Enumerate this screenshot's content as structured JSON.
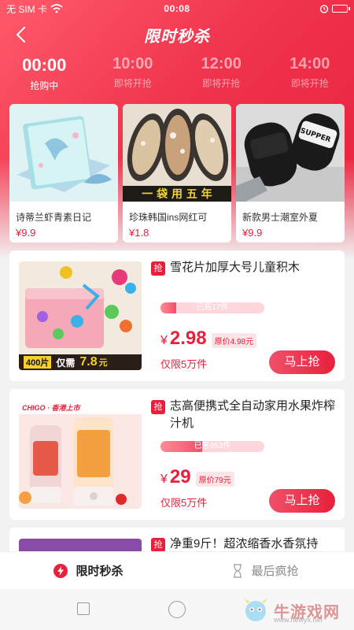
{
  "status_bar": {
    "carrier": "无 SIM 卡",
    "time": "00:08"
  },
  "nav": {
    "title": "限时秒杀"
  },
  "time_tabs": [
    {
      "time": "00:00",
      "status": "抢购中"
    },
    {
      "time": "10:00",
      "status": "即将开抢"
    },
    {
      "time": "12:00",
      "status": "即将开抢"
    },
    {
      "time": "14:00",
      "status": "即将开抢"
    }
  ],
  "hot_items": [
    {
      "name": "诗蒂兰虾青素日记",
      "price": "¥9.9",
      "image_text": ""
    },
    {
      "name": "珍珠韩国ins网红可",
      "price": "¥1.8",
      "image_text": "一 袋 用 五 年"
    },
    {
      "name": "新款男士潮室外夏",
      "price": "¥9.9",
      "image_text": "SUPPER"
    }
  ],
  "items": [
    {
      "tag": "抢",
      "title": "雪花片加厚大号儿童积木",
      "sold": "已售17件",
      "sold_fraction": 0.15,
      "currency": "¥",
      "price": "2.98",
      "original_price": "原价4.98元",
      "limit": "仅限5万件",
      "button": "马上抢",
      "image_banner_left": "400片",
      "image_banner_mid": "仅需",
      "image_banner_price": "7.8",
      "image_banner_unit": "元"
    },
    {
      "tag": "抢",
      "title": "志高便携式全自动家用水果炸榨汁机",
      "sold": "已售953件",
      "sold_fraction": 0.4,
      "currency": "¥",
      "price": "29",
      "original_price": "原价79元",
      "limit": "仅限5万件",
      "button": "马上抢",
      "image_brand": "CHIGO · 香港上市"
    },
    {
      "tag": "抢",
      "title": "净重9斤！超浓缩香水香氛持"
    }
  ],
  "bottom_tabs": [
    {
      "label": "限时秒杀",
      "icon": "lightning-icon"
    },
    {
      "label": "最后疯抢",
      "icon": "hourglass-icon"
    }
  ],
  "watermark": {
    "text": "牛游戏网",
    "url": "www.newyx.net"
  },
  "colors": {
    "accent": "#e8203c",
    "header_start": "#ff5a6a"
  }
}
